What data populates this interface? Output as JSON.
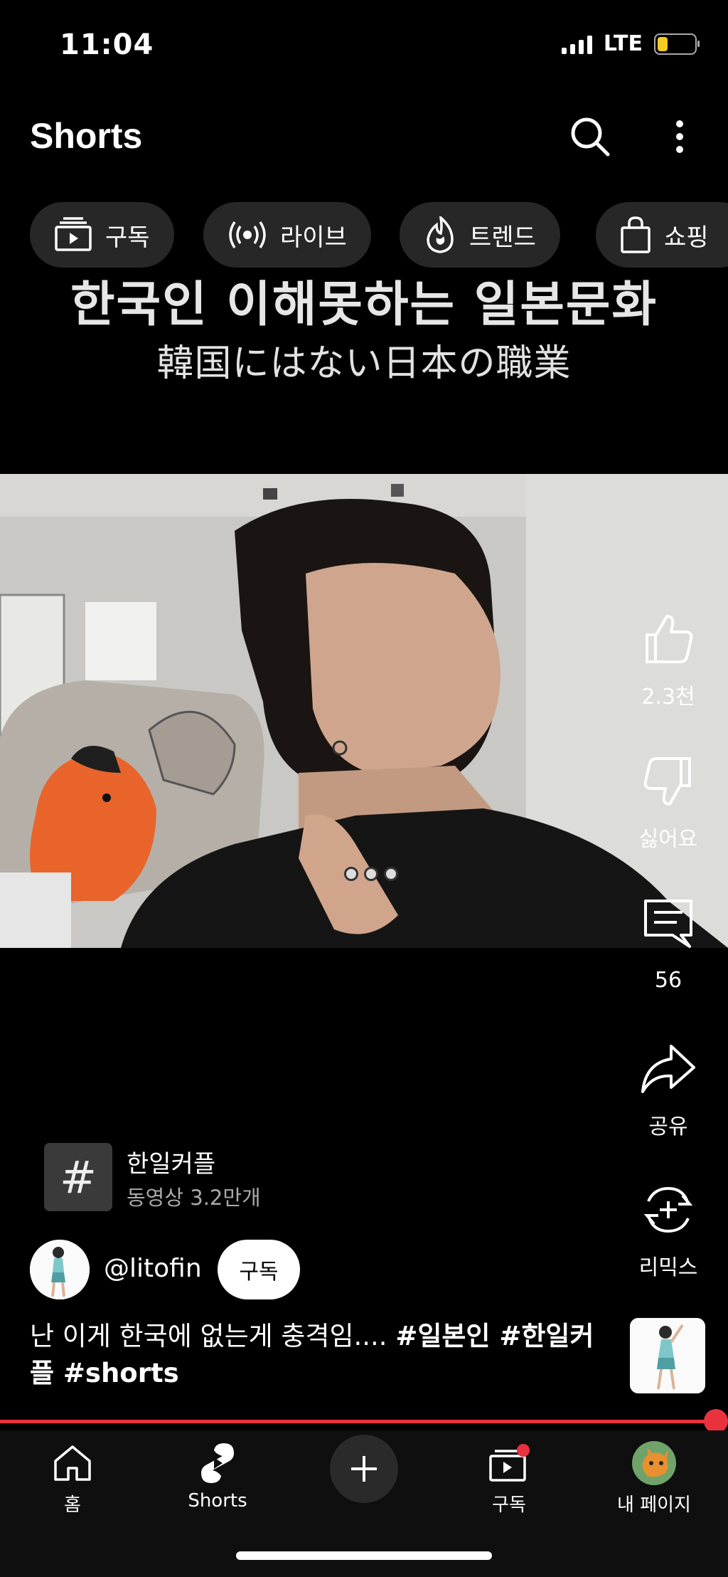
{
  "status": {
    "time": "11:04",
    "network": "LTE",
    "colors": {
      "battery": "#f5cc24"
    }
  },
  "header": {
    "title": "Shorts"
  },
  "chips": [
    {
      "label": "구독",
      "icon": "subscriptions-icon"
    },
    {
      "label": "라이브",
      "icon": "live-icon"
    },
    {
      "label": "트렌드",
      "icon": "trending-icon"
    },
    {
      "label": "쇼핑",
      "icon": "shopping-bag-icon"
    }
  ],
  "video": {
    "caption_line1": "한국인 이해못하는 일본문화",
    "caption_line2": "韓国にはない日本の職業"
  },
  "actions": {
    "like_count": "2.3천",
    "dislike_label": "싫어요",
    "comment_count": "56",
    "share_label": "공유",
    "remix_label": "리믹스"
  },
  "hashtag": {
    "symbol": "#",
    "name": "한일커플",
    "count": "동영상 3.2만개"
  },
  "channel": {
    "handle": "@litofin",
    "subscribe_label": "구독"
  },
  "description": {
    "text": "난 이게 한국에 없는게 충격임.... ",
    "tags": "#일본인 #한일커플 #shorts"
  },
  "progress": {
    "fraction": 0.985,
    "color": "#e9323e"
  },
  "nav": {
    "home": "홈",
    "shorts": "Shorts",
    "subscriptions": "구독",
    "profile": "내 페이지"
  }
}
